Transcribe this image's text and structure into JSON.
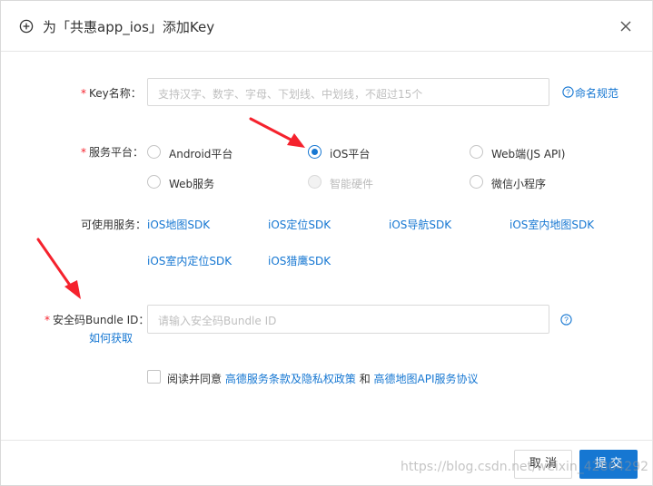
{
  "dialog": {
    "title": "为「共惠app_ios」添加Key",
    "icons": {
      "header": "plus-circle-icon",
      "close": "close-icon",
      "help": "question-circle-icon"
    }
  },
  "form": {
    "key_name": {
      "required_mark": "*",
      "label": "Key名称：",
      "placeholder": "支持汉字、数字、字母、下划线、中划线，不超过15个",
      "help_link": "命名规范"
    },
    "platform": {
      "required_mark": "*",
      "label": "服务平台：",
      "options": [
        {
          "label": "Android平台",
          "state": "unselected"
        },
        {
          "label": "iOS平台",
          "state": "selected"
        },
        {
          "label": "Web端(JS API)",
          "state": "unselected"
        },
        {
          "label": "Web服务",
          "state": "unselected"
        },
        {
          "label": "智能硬件",
          "state": "disabled"
        },
        {
          "label": "微信小程序",
          "state": "unselected"
        }
      ]
    },
    "services": {
      "label": "可使用服务：",
      "items": [
        "iOS地图SDK",
        "iOS定位SDK",
        "iOS导航SDK",
        "iOS室内地图SDK",
        "iOS室内定位SDK",
        "iOS猎鹰SDK"
      ]
    },
    "bundle_id": {
      "required_mark": "*",
      "label": "安全码Bundle ID：",
      "placeholder": "请输入安全码Bundle ID",
      "how_link": "如何获取"
    },
    "agreement": {
      "prefix": "阅读并同意",
      "terms_link": "高德服务条款及隐私权政策",
      "and": "和",
      "api_link": "高德地图API服务协议",
      "checked": false
    }
  },
  "footer": {
    "cancel_label": "取 消",
    "submit_label": "提 交"
  },
  "watermark": "https://blog.csdn.net/weixin_42864292",
  "colors": {
    "accent": "#1677d2",
    "required": "#f5222d",
    "arrow": "#f5222d"
  }
}
